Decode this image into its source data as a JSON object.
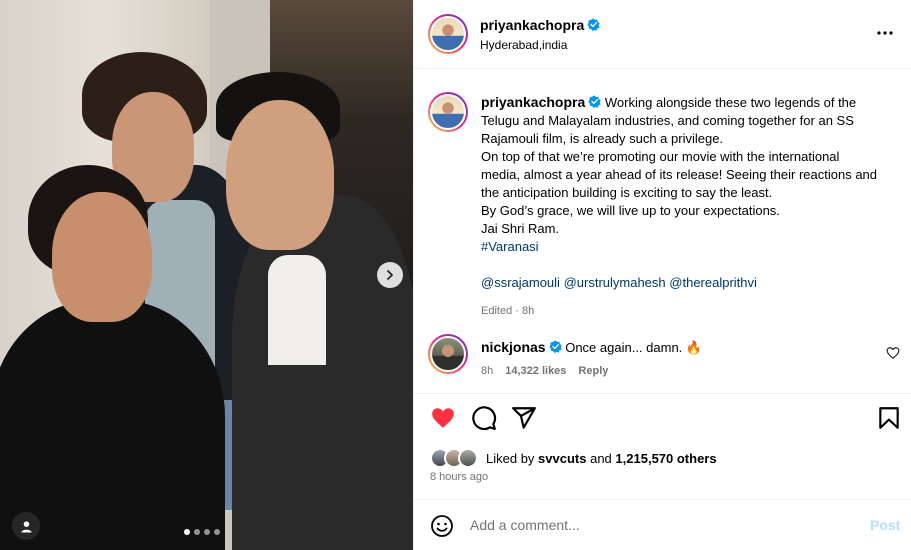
{
  "post": {
    "username": "priyankachopra",
    "location": "Hyderabad,india",
    "caption_lines": [
      "Working alongside these two legends of the",
      "Telugu and Malayalam industries, and coming together for an SS",
      "Rajamouli film, is already such a privilege.",
      "On top of that we’re promoting our movie with the international",
      "media, almost a year ahead of its release! Seeing their reactions and",
      "the anticipation building is exciting to say the least.",
      "By God’s grace, we will live up to your expectations.",
      "Jai Shri Ram."
    ],
    "hashtag": "#Varanasi",
    "mentions": [
      "@ssrajamouli",
      "@urstrulymahesh",
      "@therealprithvi"
    ],
    "edited": "Edited",
    "edited_time": "8h",
    "separator": "·"
  },
  "comment": {
    "username": "nickjonas",
    "text": "Once again... damn. 🔥",
    "time": "8h",
    "likes": "14,322 likes",
    "reply": "Reply"
  },
  "likes": {
    "prefix": "Liked by",
    "user": "svvcuts",
    "conj": "and",
    "others": "1,215,570 others"
  },
  "time_ago": "8 hours ago",
  "add_comment": {
    "placeholder": "Add a comment...",
    "post_label": "Post"
  },
  "carousel": {
    "count": 4,
    "active_index": 0
  },
  "colors": {
    "like_red": "#ff3040",
    "link_blue": "#00376b",
    "verified_blue": "#0095f6",
    "post_disabled": "#b2dffc"
  }
}
